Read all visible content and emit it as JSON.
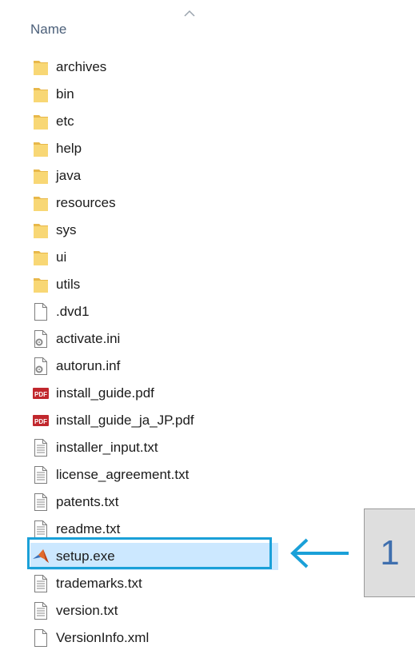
{
  "header": {
    "name_label": "Name"
  },
  "files": [
    {
      "name": "archives",
      "icon": "folder-icon"
    },
    {
      "name": "bin",
      "icon": "folder-icon"
    },
    {
      "name": "etc",
      "icon": "folder-icon"
    },
    {
      "name": "help",
      "icon": "folder-icon"
    },
    {
      "name": "java",
      "icon": "folder-icon"
    },
    {
      "name": "resources",
      "icon": "folder-icon"
    },
    {
      "name": "sys",
      "icon": "folder-icon"
    },
    {
      "name": "ui",
      "icon": "folder-icon"
    },
    {
      "name": "utils",
      "icon": "folder-icon"
    },
    {
      "name": ".dvd1",
      "icon": "blank-file-icon"
    },
    {
      "name": "activate.ini",
      "icon": "settings-file-icon"
    },
    {
      "name": "autorun.inf",
      "icon": "settings-file-icon"
    },
    {
      "name": "install_guide.pdf",
      "icon": "pdf-file-icon"
    },
    {
      "name": "install_guide_ja_JP.pdf",
      "icon": "pdf-file-icon"
    },
    {
      "name": "installer_input.txt",
      "icon": "text-file-icon"
    },
    {
      "name": "license_agreement.txt",
      "icon": "text-file-icon"
    },
    {
      "name": "patents.txt",
      "icon": "text-file-icon"
    },
    {
      "name": "readme.txt",
      "icon": "text-file-icon"
    },
    {
      "name": "setup.exe",
      "icon": "matlab-setup-icon",
      "selected": true
    },
    {
      "name": "trademarks.txt",
      "icon": "text-file-icon"
    },
    {
      "name": "version.txt",
      "icon": "text-file-icon"
    },
    {
      "name": "VersionInfo.xml",
      "icon": "blank-file-icon"
    }
  ],
  "callout": {
    "number": "1",
    "arrow_icon": "left-arrow-icon"
  },
  "colors": {
    "folder": "#f8d775",
    "selection_border": "#1aa0d8",
    "selection_fill": "#cce8ff",
    "callout_number": "#3f6fae",
    "arrow": "#1aa0d8"
  }
}
